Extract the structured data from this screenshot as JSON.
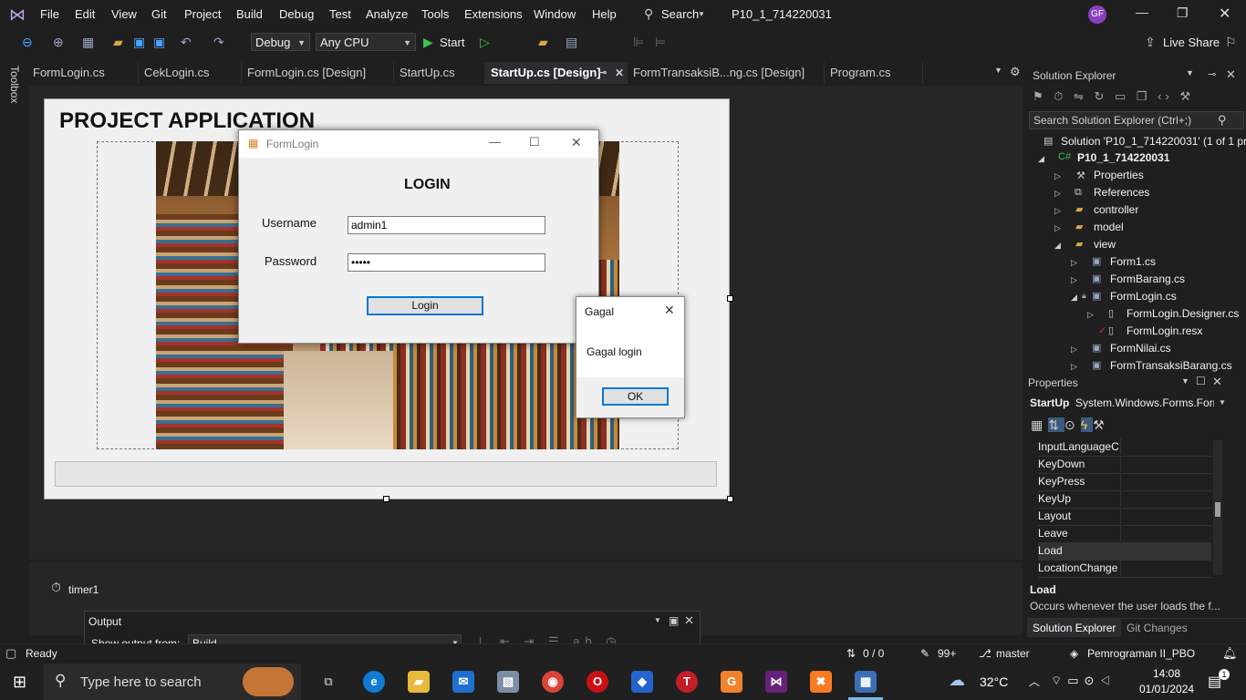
{
  "menu": {
    "items": [
      "File",
      "Edit",
      "View",
      "Git",
      "Project",
      "Build",
      "Debug",
      "Test",
      "Analyze",
      "Tools",
      "Extensions",
      "Window",
      "Help"
    ],
    "search_label": "Search",
    "solution_name": "P10_1_714220031",
    "user_initials": "GF"
  },
  "toolbar": {
    "config": "Debug",
    "platform": "Any CPU",
    "start_label": "Start",
    "live_share": "Live Share"
  },
  "toolbox_label": "Toolbox",
  "tabs": [
    {
      "label": "FormLogin.cs"
    },
    {
      "label": "CekLogin.cs"
    },
    {
      "label": "FormLogin.cs [Design]"
    },
    {
      "label": "StartUp.cs"
    },
    {
      "label": "StartUp.cs [Design]"
    },
    {
      "label": "FormTransaksiB...ng.cs [Design]"
    },
    {
      "label": "Program.cs"
    }
  ],
  "designer": {
    "form_heading": "PROJECT APPLICATION",
    "tray_component": "timer1"
  },
  "login_form": {
    "title": "FormLogin",
    "heading": "LOGIN",
    "username_label": "Username",
    "username_value": "admin1",
    "password_label": "Password",
    "password_value": "•••••",
    "login_button": "Login"
  },
  "message_box": {
    "title": "Gagal",
    "message": "Gagal login",
    "ok_button": "OK"
  },
  "solution_explorer": {
    "title": "Solution Explorer",
    "search_placeholder": "Search Solution Explorer (Ctrl+;)",
    "solution_line": "Solution 'P10_1_714220031' (1 of 1 pro",
    "project": "P10_1_714220031",
    "items": [
      "Properties",
      "References",
      "controller",
      "model",
      "view",
      "Form1.cs",
      "FormBarang.cs",
      "FormLogin.cs",
      "FormLogin.Designer.cs",
      "FormLogin.resx",
      "FormNilai.cs",
      "FormTransaksiBarang.cs"
    ]
  },
  "properties": {
    "title": "Properties",
    "object": "StartUp",
    "object_type": "System.Windows.Forms.Forr",
    "rows": [
      "InputLanguageC",
      "KeyDown",
      "KeyPress",
      "KeyUp",
      "Layout",
      "Leave",
      "Load",
      "LocationChange"
    ],
    "desc_title": "Load",
    "desc_text": "Occurs whenever the user loads the f..."
  },
  "bottom_tabs": [
    "Solution Explorer",
    "Git Changes"
  ],
  "output": {
    "title": "Output",
    "show_from_label": "Show output from:",
    "show_from_value": "Build"
  },
  "status": {
    "ready": "Ready",
    "lines": "0 / 0",
    "edits": "99+",
    "branch": "master",
    "repo": "Pemrograman II_PBO"
  },
  "taskbar": {
    "search_placeholder": "Type here to search",
    "temperature": "32°C",
    "time": "14:08",
    "date": "01/01/2024",
    "notif_count": "1"
  },
  "colors": {
    "accent": "#0078d4",
    "vs_purple": "#68217a",
    "editor_bg": "#1f1f1f",
    "active_tab": "#2d2d30"
  }
}
